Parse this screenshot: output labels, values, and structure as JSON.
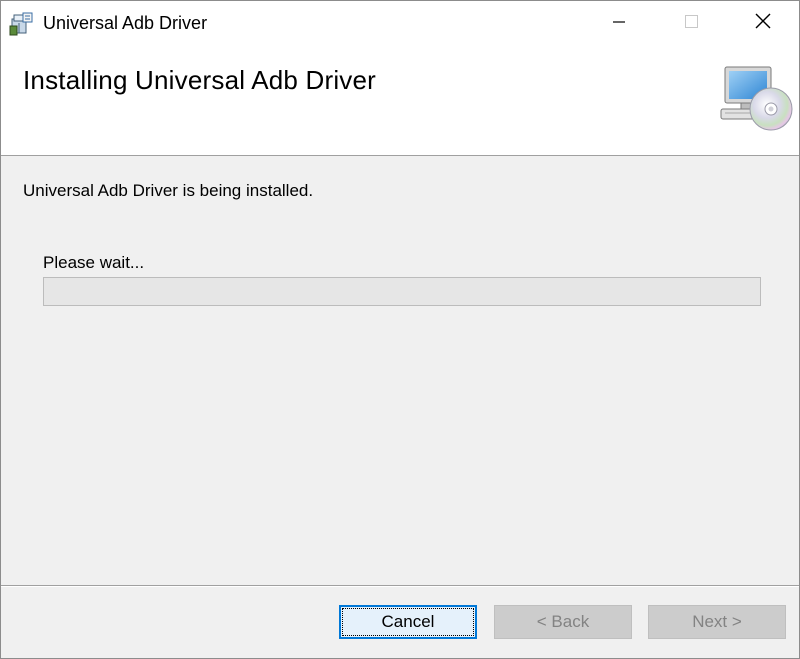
{
  "window": {
    "title": "Universal Adb Driver",
    "app_icon": "installer-box-icon",
    "controls": {
      "minimize_icon": "minimize-icon",
      "maximize_icon": "maximize-icon",
      "close_icon": "close-icon"
    }
  },
  "header": {
    "title": "Installing Universal Adb Driver",
    "icon": "computer-cd-icon"
  },
  "body": {
    "status": "Universal Adb Driver is being installed.",
    "wait_label": "Please wait...",
    "progress": 0
  },
  "footer": {
    "cancel_label": "Cancel",
    "back_label": "< Back",
    "next_label": "Next >"
  },
  "colors": {
    "focus_border": "#0078d7",
    "dialog_bg": "#f0f0f0",
    "disabled_text": "#838383"
  }
}
